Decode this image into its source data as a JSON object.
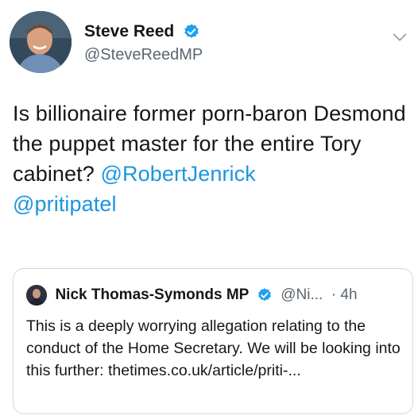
{
  "author": {
    "display_name": "Steve Reed",
    "handle": "@SteveReedMP"
  },
  "tweet": {
    "text_main": "Is billionaire former porn-baron Desmond the puppet master for the entire Tory cabinet? ",
    "mention_1": "@RobertJenrick",
    "mention_2": "@pritipatel"
  },
  "quoted_tweet": {
    "display_name": "Nick Thomas-Symonds MP",
    "handle": "@Ni...",
    "time": "· 4h",
    "text": "This is a deeply worrying allegation relating to the conduct of the Home Secretary. We will be looking into this further: thetimes.co.uk/article/priti-..."
  },
  "colors": {
    "link": "#1b95e0",
    "verified": "#1da1f2",
    "text": "#14171a",
    "secondary": "#5b6670",
    "border": "#cfd9de"
  },
  "icons": [
    "verified-badge-icon",
    "chevron-down-icon"
  ]
}
